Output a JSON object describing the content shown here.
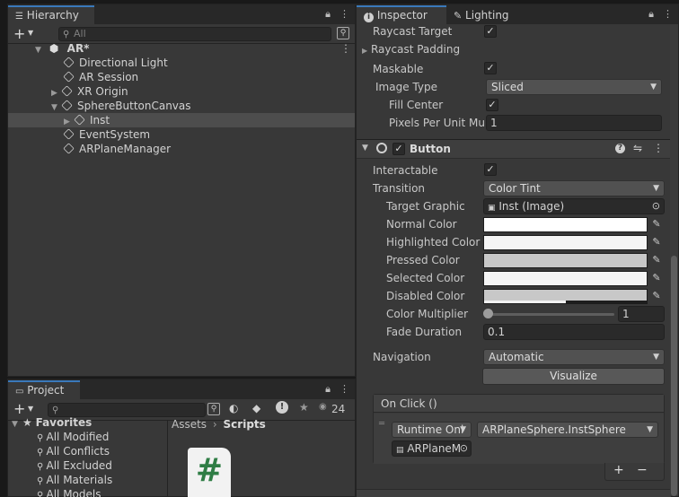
{
  "hierarchy": {
    "tab_label": "Hierarchy",
    "search_placeholder": "All",
    "scene_name": "AR*",
    "items": [
      {
        "label": "Directional Light"
      },
      {
        "label": "AR Session"
      },
      {
        "label": "XR Origin"
      },
      {
        "label": "SphereButtonCanvas"
      },
      {
        "label": "Inst"
      },
      {
        "label": "EventSystem"
      },
      {
        "label": "ARPlaneManager"
      }
    ]
  },
  "project": {
    "tab_label": "Project",
    "hidden_count": "24",
    "favorites_label": "Favorites",
    "favorites": [
      "All Modified",
      "All Conflicts",
      "All Excluded",
      "All Materials",
      "All Models"
    ],
    "breadcrumb": [
      "Assets",
      "Scripts"
    ],
    "script_glyph": "#"
  },
  "inspector": {
    "tab_label": "Inspector",
    "lighting_tab_label": "Lighting",
    "image": {
      "raycast_target_label": "Raycast Target",
      "raycast_padding_label": "Raycast Padding",
      "maskable_label": "Maskable",
      "image_type_label": "Image Type",
      "image_type_value": "Sliced",
      "fill_center_label": "Fill Center",
      "ppu_label": "Pixels Per Unit Mul",
      "ppu_value": "1"
    },
    "button": {
      "title": "Button",
      "interactable_label": "Interactable",
      "transition_label": "Transition",
      "transition_value": "Color Tint",
      "target_graphic_label": "Target Graphic",
      "target_graphic_value": "Inst (Image)",
      "normal_color_label": "Normal Color",
      "highlighted_color_label": "Highlighted Color",
      "pressed_color_label": "Pressed Color",
      "selected_color_label": "Selected Color",
      "disabled_color_label": "Disabled Color",
      "color_multiplier_label": "Color Multiplier",
      "color_multiplier_value": "1",
      "color_multiplier_fraction": 0.0,
      "fade_duration_label": "Fade Duration",
      "fade_duration_value": "0.1",
      "navigation_label": "Navigation",
      "navigation_value": "Automatic",
      "visualize_label": "Visualize",
      "onclick_label": "On Click ()",
      "runtime_value": "Runtime Onl",
      "function_value": "ARPlaneSphere.InstSphere",
      "object_value": "ARPlaneM",
      "add_label": "+",
      "remove_label": "−",
      "colors": {
        "normal": "#ffffff",
        "highlighted": "#f5f5f5",
        "pressed": "#c8c8c8",
        "selected": "#f5f5f5",
        "disabled": "#c8c8c8"
      }
    }
  },
  "theme": {
    "accent": "#3a79bb",
    "panel_bg": "#383838"
  }
}
